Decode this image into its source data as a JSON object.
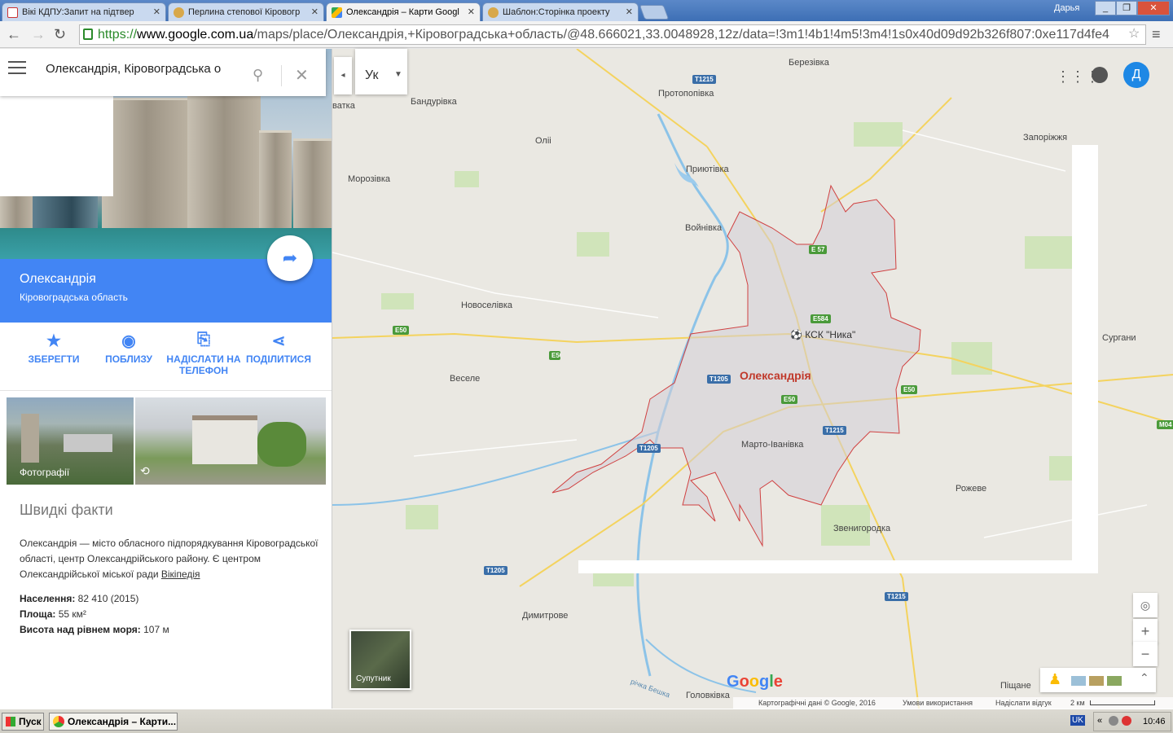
{
  "browser": {
    "tabs": [
      {
        "label": "Вікі КДПУ:Запит на підтвер",
        "icon": "gmail-icon"
      },
      {
        "label": "Перлина степової Кіровогр",
        "icon": "wiki-icon"
      },
      {
        "label": "Олександрія – Карти Googl",
        "icon": "google-maps-icon"
      },
      {
        "label": "Шаблон:Сторінка проекту",
        "icon": "wiki-icon"
      }
    ],
    "user": "Дарья",
    "url_scheme": "https://",
    "url_host": "www.google.com.ua",
    "url_path": "/maps/place/Олександрія,+Кіровоградська+область/@48.666021,33.0048928,12z/data=!3m1!4b1!4m5!3m4!1s0x40d09d92b326f807:0xe117d4fe4"
  },
  "search": {
    "value": "Олександрія, Кіровоградська о"
  },
  "place": {
    "name": "Олександрія",
    "region": "Кіровоградська область",
    "route_label": "Маршрути"
  },
  "actions": [
    {
      "label": "ЗБЕРЕГТИ",
      "icon": "star-icon"
    },
    {
      "label": "ПОБЛИЗУ",
      "icon": "nearby-icon"
    },
    {
      "label": "НАДІСЛАТИ НА ТЕЛЕФОН",
      "icon": "send-to-phone-icon"
    },
    {
      "label": "ПОДІЛИТИСЯ",
      "icon": "share-icon"
    }
  ],
  "photos": {
    "photos_label": "Фотографії"
  },
  "facts": {
    "heading": "Швидкі факти",
    "description": "Олександрія — місто обласного підпорядкування Кіровоградської області, центр Олександрійського району. Є центром Олександрійської міської ради",
    "wiki_link": "Вікіпедія",
    "population_label": "Населення:",
    "population_value": "82 410 (2015)",
    "area_label": "Площа:",
    "area_value": "55 км²",
    "elevation_label": "Висота над рівнем моря:",
    "elevation_value": "107 м"
  },
  "map": {
    "lang": "Ук",
    "avatar_letter": "Д",
    "city_label": "Олександрія",
    "poi_label": "КСК \"Ника\"",
    "villages": [
      "Березівка",
      "Бандурівка",
      "Протопопівка",
      "Оліі",
      "Запоріжжя",
      "Морозівка",
      "Приютівка",
      "Войнівка",
      "Новоселівка",
      "Веселе",
      "Сургани",
      "Марто-Іванівка",
      "Рожеве",
      "Звенигородка",
      "Димитрове",
      "Головківка",
      "Піщане",
      "річка Бешка",
      "ватка"
    ],
    "shields": [
      "T1215",
      "E 57",
      "E584",
      "E50",
      "E50",
      "T1205",
      "E50",
      "T1215",
      "T1205",
      "T1205",
      "T1215",
      "E50",
      "M04"
    ],
    "satellite_label": "Супутник",
    "google_logo": "Google",
    "footer_copyright": "Картографічні дані © Google, 2016",
    "footer_terms": "Умови використання",
    "footer_feedback": "Надіслати відгук",
    "footer_scale": "2 км"
  },
  "taskbar": {
    "start": "Пуск",
    "item": "Олександрія – Карти...",
    "kb": "UK",
    "clock": "10:46"
  },
  "colors": {
    "accent": "#4285f4",
    "city_boundary": "#d04040",
    "city_label": "#c0392b"
  }
}
